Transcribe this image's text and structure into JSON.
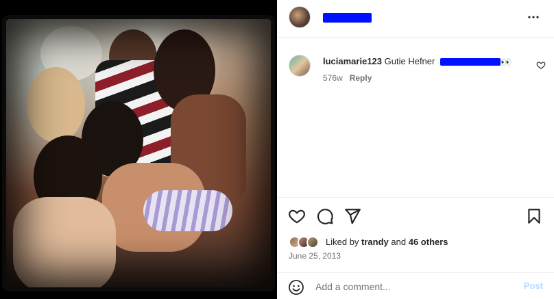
{
  "post": {
    "header": {
      "username_redacted": true,
      "more_icon": "more-horizontal-icon"
    },
    "comments": [
      {
        "username": "luciamarie123",
        "text": "Gutie Hefner",
        "text_redacted": true,
        "emoji": "👀",
        "age": "576w",
        "reply_label": "Reply"
      }
    ],
    "actions": {
      "like_icon": "heart-icon",
      "comment_icon": "comment-bubble-icon",
      "share_icon": "paper-plane-icon",
      "save_icon": "bookmark-icon"
    },
    "likes": {
      "prefix": "Liked by",
      "first_user": "trandy",
      "conjunction": "and",
      "others": "46 others"
    },
    "date": "June 25, 2013",
    "add_comment": {
      "placeholder": "Add a comment...",
      "post_label": "Post"
    }
  },
  "colors": {
    "redaction": "#0011ff",
    "post_button_disabled": "#b3dbff",
    "muted_text": "#737373"
  }
}
